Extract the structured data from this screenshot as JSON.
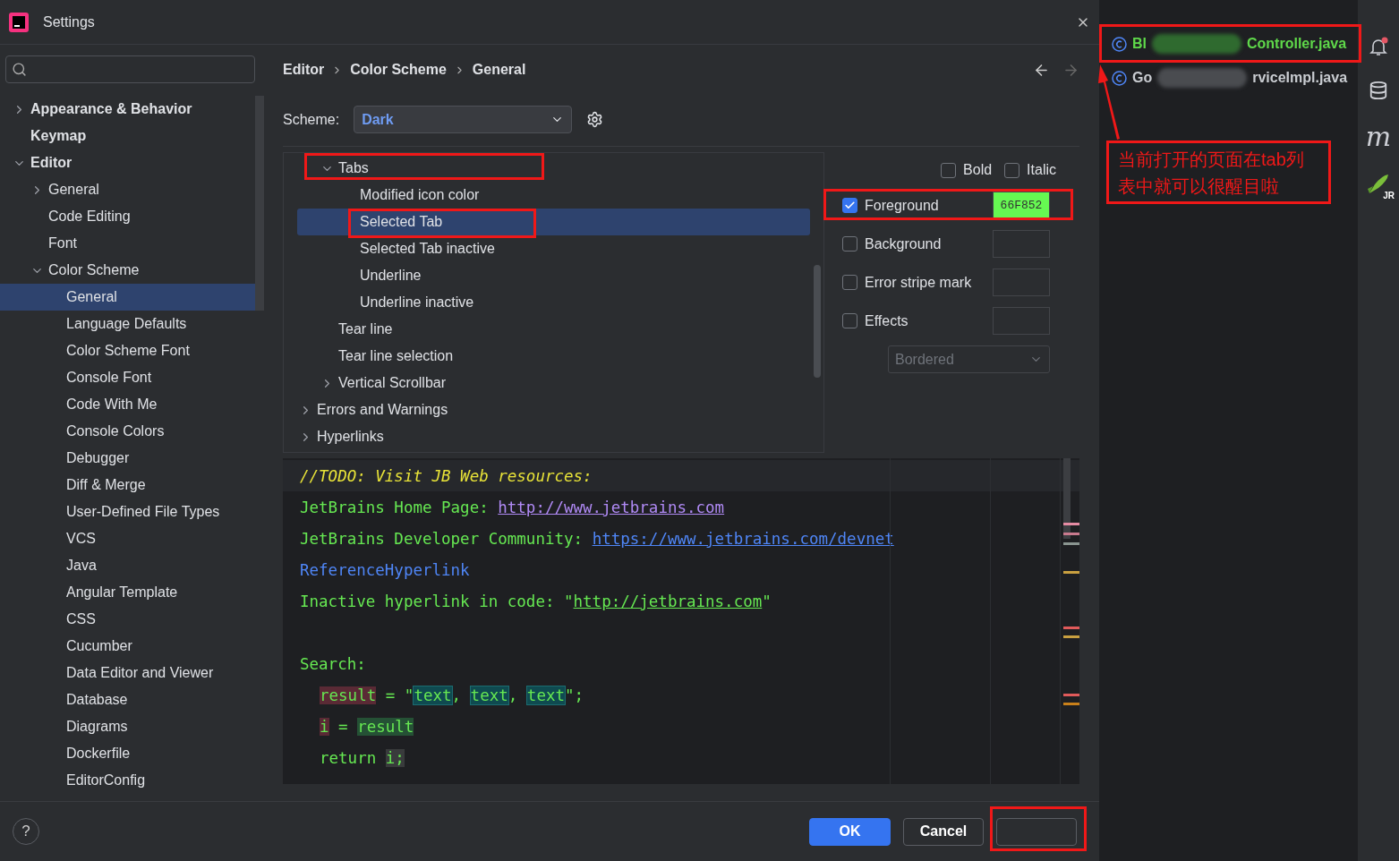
{
  "window": {
    "title": "Settings"
  },
  "sidebar": {
    "items": [
      {
        "label": "Appearance & Behavior",
        "expanded": false,
        "selected": false
      },
      {
        "label": "Keymap",
        "selected": false
      },
      {
        "label": "Editor",
        "expanded": true,
        "selected": false,
        "children": [
          {
            "label": "General",
            "expanded": false,
            "selected": false
          },
          {
            "label": "Code Editing",
            "selected": false
          },
          {
            "label": "Font",
            "selected": false
          },
          {
            "label": "Color Scheme",
            "expanded": true,
            "selected": false,
            "children": [
              {
                "label": "General",
                "selected": true
              },
              {
                "label": "Language Defaults",
                "selected": false
              },
              {
                "label": "Color Scheme Font",
                "selected": false
              },
              {
                "label": "Console Font",
                "selected": false
              },
              {
                "label": "Code With Me",
                "selected": false
              },
              {
                "label": "Console Colors",
                "selected": false
              },
              {
                "label": "Debugger",
                "selected": false
              },
              {
                "label": "Diff & Merge",
                "selected": false
              },
              {
                "label": "User-Defined File Types",
                "selected": false
              },
              {
                "label": "VCS",
                "selected": false
              },
              {
                "label": "Java",
                "selected": false
              },
              {
                "label": "Angular Template",
                "selected": false
              },
              {
                "label": "CSS",
                "selected": false
              },
              {
                "label": "Cucumber",
                "selected": false
              },
              {
                "label": "Data Editor and Viewer",
                "selected": false
              },
              {
                "label": "Database",
                "selected": false
              },
              {
                "label": "Diagrams",
                "selected": false
              },
              {
                "label": "Dockerfile",
                "selected": false
              },
              {
                "label": "EditorConfig",
                "selected": false
              }
            ]
          }
        ]
      }
    ]
  },
  "breadcrumb": [
    "Editor",
    "Color Scheme",
    "General"
  ],
  "scheme": {
    "label": "Scheme:",
    "value": "Dark"
  },
  "tree": [
    {
      "expanded": true,
      "children": [
        {
          "label": "Tabs",
          "expanded": true,
          "selected": false,
          "children": [
            {
              "label": "Modified icon color",
              "selected": false
            },
            {
              "label": "Selected Tab",
              "selected": true
            },
            {
              "label": "Selected Tab inactive",
              "selected": false
            },
            {
              "label": "Underline",
              "selected": false
            },
            {
              "label": "Underline inactive",
              "selected": false
            }
          ]
        },
        {
          "label": "Tear line",
          "selected": false
        },
        {
          "label": "Tear line selection",
          "selected": false
        },
        {
          "label": "Vertical Scrollbar",
          "expanded": false,
          "selected": false
        }
      ]
    },
    {
      "label": "Errors and Warnings",
      "expanded": false,
      "selected": false
    },
    {
      "label": "Hyperlinks",
      "expanded": false,
      "selected": false
    }
  ],
  "options": {
    "bold": {
      "label": "Bold",
      "checked": false
    },
    "italic": {
      "label": "Italic",
      "checked": false
    },
    "attributes": [
      {
        "label": "Foreground",
        "checked": true,
        "value": "66F852",
        "color": "#66f852"
      },
      {
        "label": "Background",
        "checked": false
      },
      {
        "label": "Error stripe mark",
        "checked": false
      },
      {
        "label": "Effects",
        "checked": false
      }
    ],
    "effect": {
      "value": "Bordered",
      "disabled": true
    }
  },
  "preview": [
    {
      "kind": "code",
      "indent": false,
      "segments": [
        {
          "kind": "todo",
          "text": "//TODO: Visit JB Web resources:"
        }
      ]
    },
    {
      "kind": "code",
      "indent": false,
      "segments": [
        {
          "kind": "plain",
          "text": "JetBrains Home Page: "
        },
        {
          "kind": "visited",
          "text": "http://www.jetbrains.com"
        }
      ]
    },
    {
      "kind": "code",
      "indent": false,
      "segments": [
        {
          "kind": "plain",
          "text": "JetBrains Developer Community: "
        },
        {
          "kind": "link",
          "text": "https://www.jetbrains.com/devnet"
        }
      ]
    },
    {
      "kind": "code",
      "indent": false,
      "segments": [
        {
          "kind": "reference",
          "text": "ReferenceHyperlink"
        }
      ]
    },
    {
      "kind": "code",
      "indent": false,
      "segments": [
        {
          "kind": "plain",
          "text": "Inactive hyperlink in code: \""
        },
        {
          "kind": "inactive",
          "text": "http://jetbrains.com"
        },
        {
          "kind": "plain",
          "text": "\""
        }
      ]
    },
    {
      "kind": "blank"
    },
    {
      "kind": "code",
      "indent": false,
      "segments": [
        {
          "kind": "plain",
          "text": "Search:"
        }
      ]
    },
    {
      "kind": "code",
      "indent": true,
      "segments": [
        {
          "kind": "write",
          "text": "result"
        },
        {
          "kind": "plain",
          "text": " = \""
        },
        {
          "kind": "found",
          "text": "text"
        },
        {
          "kind": "plain",
          "text": ", "
        },
        {
          "kind": "found",
          "text": "text"
        },
        {
          "kind": "plain",
          "text": ", "
        },
        {
          "kind": "found",
          "text": "text"
        },
        {
          "kind": "plain",
          "text": "\";"
        }
      ]
    },
    {
      "kind": "code",
      "indent": true,
      "segments": [
        {
          "kind": "write",
          "text": "i"
        },
        {
          "kind": "plain",
          "text": " = "
        },
        {
          "kind": "read",
          "text": "result"
        }
      ]
    },
    {
      "kind": "code",
      "indent": true,
      "segments": [
        {
          "kind": "plain",
          "text": "return "
        },
        {
          "kind": "usage",
          "text": "i;"
        }
      ]
    }
  ],
  "footer": {
    "help": "?",
    "buttons": [
      {
        "label": "OK",
        "kind": "primary"
      },
      {
        "label": "Cancel",
        "kind": "normal"
      },
      {
        "kind": "blank"
      }
    ]
  },
  "files": [
    {
      "start": "Bl",
      "end": "Controller.java",
      "selected": true
    },
    {
      "start": "Go",
      "end": "rviceImpl.java",
      "selected": false
    }
  ],
  "toolbar": {
    "letter": "m",
    "badge": "JR"
  },
  "annotation": {
    "text": "当前打开的页面在tab列表中就可以很醒目啦"
  }
}
